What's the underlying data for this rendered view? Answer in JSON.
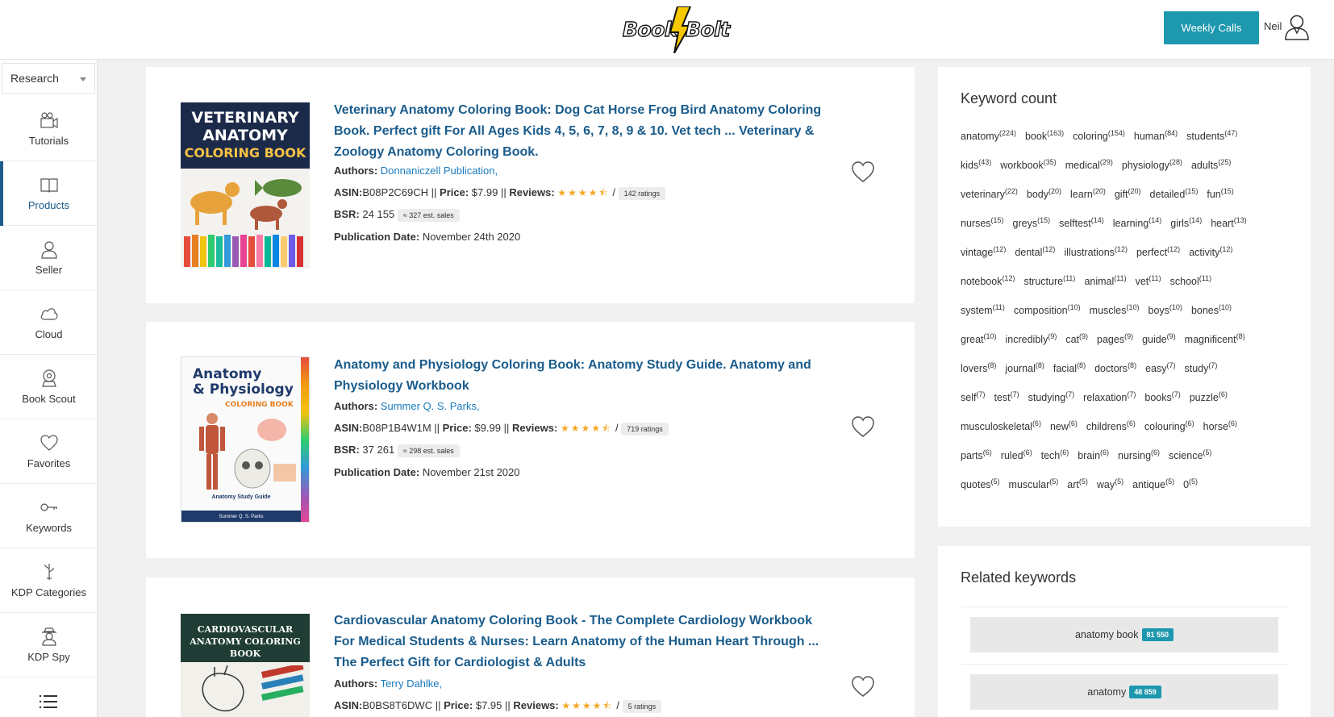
{
  "header": {
    "logo_left": "Book",
    "logo_right": "Bolt",
    "weekly_calls_label": "Weekly Calls",
    "user_name": "Neil"
  },
  "colors": {
    "accent": "#1e98af",
    "title_blue": "#1a5c8c",
    "star": "#f5a623",
    "bolt": "#f5c800"
  },
  "sidebar": {
    "research_label": "Research",
    "items": [
      {
        "label": "Tutorials",
        "icon": "video-camera-icon"
      },
      {
        "label": "Products",
        "icon": "book-icon",
        "active": true
      },
      {
        "label": "Seller",
        "icon": "user-icon"
      },
      {
        "label": "Cloud",
        "icon": "cloud-icon"
      },
      {
        "label": "Book Scout",
        "icon": "scout-icon"
      },
      {
        "label": "Favorites",
        "icon": "heart-icon"
      },
      {
        "label": "Keywords",
        "icon": "key-icon"
      },
      {
        "label": "KDP Categories",
        "icon": "tree-icon"
      },
      {
        "label": "KDP Spy",
        "icon": "spy-icon"
      }
    ]
  },
  "products": [
    {
      "cover_lines": [
        "VETERINARY",
        "ANATOMY",
        "COLORING BOOK"
      ],
      "title": "Veterinary Anatomy Coloring Book: Dog Cat Horse Frog Bird Anatomy Coloring Book. Perfect gift For All Ages Kids 4, 5, 6, 7, 8, 9 & 10. Vet tech ... Veterinary & Zoology Anatomy Coloring Book.",
      "authors_label": "Authors:",
      "authors": "Donnaniczell Publication,",
      "asin_label": "ASIN:",
      "asin": "B08P2C69CH",
      "price_label": "Price:",
      "price": "$7.99",
      "reviews_label": "Reviews:",
      "rating": 4.5,
      "ratings_count": "142 ratings",
      "bsr_label": "BSR:",
      "bsr": "24 155",
      "est_sales": "≈ 327 est. sales",
      "pubdate_label": "Publication Date:",
      "pubdate": "November 24th 2020"
    },
    {
      "cover_lines": [
        "Anatomy",
        "& Physiology",
        "COLORING BOOK",
        "Anatomy Study Guide",
        "Summer Q. S. Parks"
      ],
      "title": "Anatomy and Physiology Coloring Book: Anatomy Study Guide. Anatomy and Physiology Workbook",
      "authors_label": "Authors:",
      "authors": "Summer Q. S. Parks,",
      "asin_label": "ASIN:",
      "asin": "B08P1B4W1M",
      "price_label": "Price:",
      "price": "$9.99",
      "reviews_label": "Reviews:",
      "rating": 4.5,
      "ratings_count": "719 ratings",
      "bsr_label": "BSR:",
      "bsr": "37 261",
      "est_sales": "≈ 298 est. sales",
      "pubdate_label": "Publication Date:",
      "pubdate": "November 21st 2020"
    },
    {
      "cover_lines": [
        "CARDIOVASCULAR",
        "ANATOMY COLORING BOOK"
      ],
      "title": "Cardiovascular Anatomy Coloring Book - The Complete Cardiology Workbook For Medical Students & Nurses: Learn Anatomy of the Human Heart Through ... The Perfect Gift for Cardiologist & Adults",
      "authors_label": "Authors:",
      "authors": "Terry Dahlke,",
      "asin_label": "ASIN:",
      "asin": "B0BS8T6DWC",
      "price_label": "Price:",
      "price": "$7.95",
      "reviews_label": "Reviews:",
      "rating": 4.5,
      "ratings_count": "5 ratings"
    }
  ],
  "keyword_count": {
    "title": "Keyword count",
    "lines": [
      [
        [
          "anatomy",
          "224"
        ],
        [
          "book",
          "163"
        ],
        [
          "coloring",
          "154"
        ],
        [
          "human",
          "84"
        ],
        [
          "students",
          "47"
        ]
      ],
      [
        [
          "kids",
          "43"
        ],
        [
          "workbook",
          "35"
        ],
        [
          "medical",
          "29"
        ],
        [
          "physiology",
          "28"
        ],
        [
          "adults",
          "25"
        ]
      ],
      [
        [
          "veterinary",
          "22"
        ],
        [
          "body",
          "20"
        ],
        [
          "learn",
          "20"
        ],
        [
          "gift",
          "20"
        ],
        [
          "detailed",
          "15"
        ],
        [
          "fun",
          "15"
        ]
      ],
      [
        [
          "nurses",
          "15"
        ],
        [
          "greys",
          "15"
        ],
        [
          "selftest",
          "14"
        ],
        [
          "learning",
          "14"
        ],
        [
          "girls",
          "14"
        ],
        [
          "heart",
          "13"
        ]
      ],
      [
        [
          "vintage",
          "12"
        ],
        [
          "dental",
          "12"
        ],
        [
          "illustrations",
          "12"
        ],
        [
          "perfect",
          "12"
        ],
        [
          "activity",
          "12"
        ]
      ],
      [
        [
          "notebook",
          "12"
        ],
        [
          "structure",
          "11"
        ],
        [
          "animal",
          "11"
        ],
        [
          "vet",
          "11"
        ],
        [
          "school",
          "11"
        ]
      ],
      [
        [
          "system",
          "11"
        ],
        [
          "composition",
          "10"
        ],
        [
          "muscles",
          "10"
        ],
        [
          "boys",
          "10"
        ],
        [
          "bones",
          "10"
        ]
      ],
      [
        [
          "great",
          "10"
        ],
        [
          "incredibly",
          "9"
        ],
        [
          "cat",
          "9"
        ],
        [
          "pages",
          "9"
        ],
        [
          "guide",
          "9"
        ],
        [
          "magnificent",
          "8"
        ]
      ],
      [
        [
          "lovers",
          "8"
        ],
        [
          "journal",
          "8"
        ],
        [
          "facial",
          "8"
        ],
        [
          "doctors",
          "8"
        ],
        [
          "easy",
          "7"
        ],
        [
          "study",
          "7"
        ]
      ],
      [
        [
          "self",
          "7"
        ],
        [
          "test",
          "7"
        ],
        [
          "studying",
          "7"
        ],
        [
          "relaxation",
          "7"
        ],
        [
          "books",
          "7"
        ],
        [
          "puzzle",
          "6"
        ]
      ],
      [
        [
          "musculoskeletal",
          "6"
        ],
        [
          "new",
          "6"
        ],
        [
          "childrens",
          "6"
        ],
        [
          "colouring",
          "6"
        ],
        [
          "horse",
          "6"
        ]
      ],
      [
        [
          "parts",
          "6"
        ],
        [
          "ruled",
          "6"
        ],
        [
          "tech",
          "6"
        ],
        [
          "brain",
          "6"
        ],
        [
          "nursing",
          "6"
        ],
        [
          "science",
          "5"
        ]
      ],
      [
        [
          "quotes",
          "5"
        ],
        [
          "muscular",
          "5"
        ],
        [
          "art",
          "5"
        ],
        [
          "way",
          "5"
        ],
        [
          "antique",
          "5"
        ],
        [
          "0",
          "5"
        ]
      ]
    ]
  },
  "related_keywords": {
    "title": "Related keywords",
    "items": [
      {
        "label": "anatomy book",
        "count": "81 550"
      },
      {
        "label": "anatomy",
        "count": "48 859"
      }
    ]
  }
}
